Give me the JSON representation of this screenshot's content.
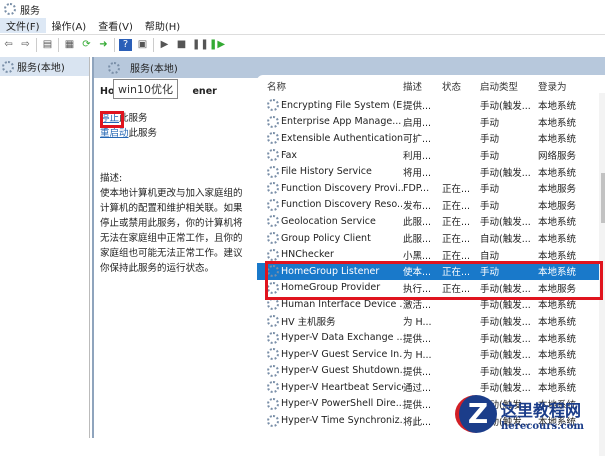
{
  "window": {
    "title": "服务"
  },
  "menu": [
    "文件(F)",
    "操作(A)",
    "查看(V)",
    "帮助(H)"
  ],
  "tree": {
    "item": "服务(本地)"
  },
  "panel": {
    "header": "服务(本地)",
    "service_title_visible": "Ho",
    "service_title_tail": "ener",
    "tooltip": "win10优化",
    "stop_link": "停止",
    "stop_suffix": "此服务",
    "restart_link": "重启动",
    "restart_suffix": "此服务",
    "desc_label": "描述:",
    "description": "使本地计算机更改与加入家庭组的计算机的配置和维护相关联。如果停止或禁用此服务，你的计算机将无法在家庭组中正常工作，且你的家庭组也可能无法正常工作。建议你保持此服务的运行状态。"
  },
  "columns": [
    "名称",
    "描述",
    "状态",
    "启动类型",
    "登录为"
  ],
  "rows": [
    [
      "Encrypting File System (E...",
      "提供...",
      "",
      "手动(触发...",
      "本地系统"
    ],
    [
      "Enterprise App Manage...",
      "启用...",
      "",
      "手动",
      "本地系统"
    ],
    [
      "Extensible Authentication...",
      "可扩...",
      "",
      "手动",
      "本地系统"
    ],
    [
      "Fax",
      "利用...",
      "",
      "手动",
      "网络服务"
    ],
    [
      "File History Service",
      "将用...",
      "",
      "手动(触发...",
      "本地系统"
    ],
    [
      "Function Discovery Provi...",
      "FDP...",
      "正在...",
      "手动",
      "本地服务"
    ],
    [
      "Function Discovery Reso...",
      "发布...",
      "正在...",
      "手动",
      "本地服务"
    ],
    [
      "Geolocation Service",
      "此服...",
      "正在...",
      "手动(触发...",
      "本地系统"
    ],
    [
      "Group Policy Client",
      "此服...",
      "正在...",
      "自动(触发...",
      "本地系统"
    ],
    [
      "HNChecker",
      "小黑...",
      "正在...",
      "自动",
      "本地系统"
    ],
    [
      "HomeGroup Listener",
      "使本...",
      "正在...",
      "手动",
      "本地系统"
    ],
    [
      "HomeGroup Provider",
      "执行...",
      "正在...",
      "手动(触发...",
      "本地服务"
    ],
    [
      "Human Interface Device ...",
      "激活...",
      "",
      "手动(触发...",
      "本地系统"
    ],
    [
      "HV 主机服务",
      "为 H...",
      "",
      "手动(触发...",
      "本地系统"
    ],
    [
      "Hyper-V Data Exchange ...",
      "提供...",
      "",
      "手动(触发...",
      "本地系统"
    ],
    [
      "Hyper-V Guest Service In...",
      "为 H...",
      "",
      "手动(触发...",
      "本地系统"
    ],
    [
      "Hyper-V Guest Shutdown...",
      "提供...",
      "",
      "手动(触发...",
      "本地系统"
    ],
    [
      "Hyper-V Heartbeat Service",
      "通过...",
      "",
      "手动(触发...",
      "本地系统"
    ],
    [
      "Hyper-V PowerShell Dire...",
      "提供...",
      "",
      "手动(触发...",
      "本地系统"
    ],
    [
      "Hyper-V Time Synchroniz...",
      "将此...",
      "",
      "手动(触发...",
      "本地系统"
    ]
  ],
  "selected_row": 10,
  "watermark": {
    "name": "这里教程网",
    "url": "herecours.com"
  }
}
